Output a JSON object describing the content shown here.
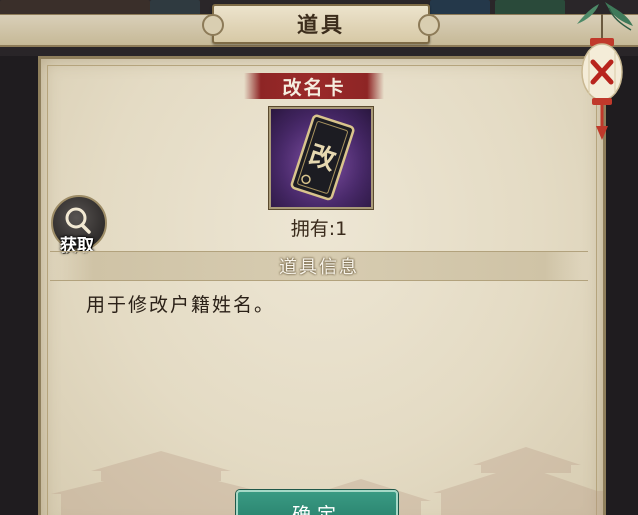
{
  "header": {
    "title": "道具"
  },
  "item": {
    "name": "改名卡",
    "icon": "rename-card-icon",
    "icon_glyph": "改",
    "owned_text": "拥有:1"
  },
  "acquire": {
    "label": "获取",
    "icon": "magnifier-icon"
  },
  "section": {
    "title": "道具信息"
  },
  "description": "用于修改户籍姓名。",
  "confirm": {
    "label": "确定"
  },
  "close": {
    "icon": "lantern-close-icon"
  },
  "colors": {
    "ribbon": "#9a2a2a",
    "confirm_button": "#2e8a74",
    "panel": "#e6ddc8",
    "item_bg": "#4b2a6e"
  }
}
